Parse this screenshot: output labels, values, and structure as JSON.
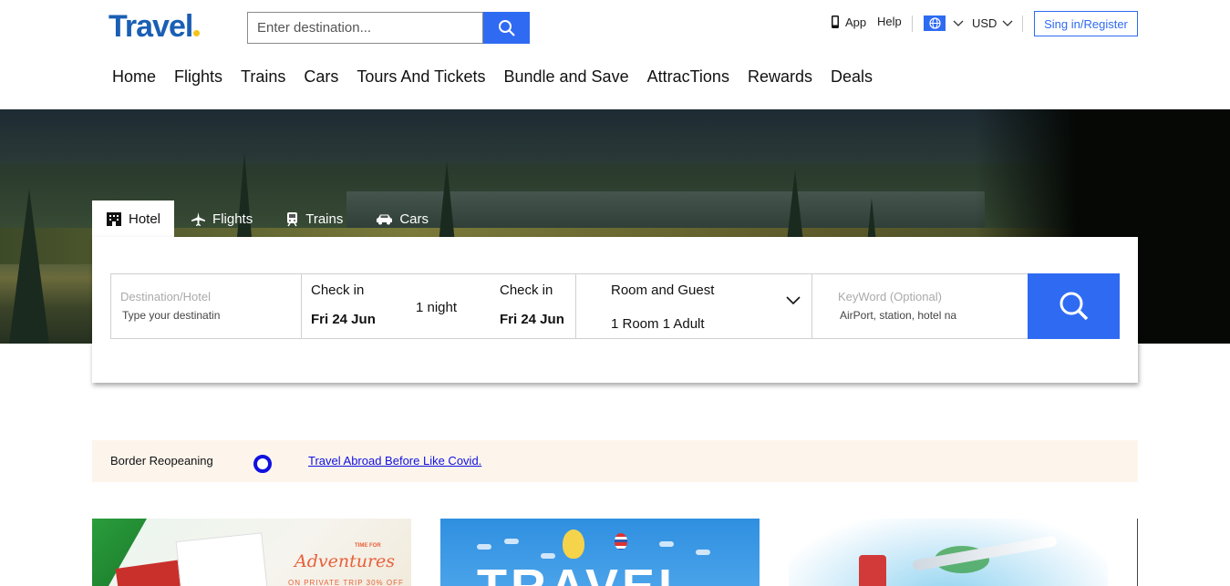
{
  "header": {
    "logo": "Travel",
    "search_placeholder": "Enter destination...",
    "app_label": "App",
    "help_label": "Help",
    "currency": "USD",
    "signin_label": "Sing in/Register"
  },
  "nav": [
    "Home",
    "Flights",
    "Trains",
    "Cars",
    "Tours And Tickets",
    "Bundle and Save",
    "AttracTions",
    "Rewards",
    "Deals"
  ],
  "tabs": [
    {
      "label": "Hotel",
      "icon": "hotel-icon",
      "active": true
    },
    {
      "label": "Flights",
      "icon": "plane-icon",
      "active": false
    },
    {
      "label": "Trains",
      "icon": "train-icon",
      "active": false
    },
    {
      "label": "Cars",
      "icon": "car-icon",
      "active": false
    }
  ],
  "search_panel": {
    "destination_label": "Destination/Hotel",
    "destination_placeholder": "Type your destinatin",
    "checkin_label": "Check in",
    "checkin_value": "Fri 24 Jun",
    "nights": "1 night",
    "checkout_label": "Check in",
    "checkout_value": "Fri 24 Jun",
    "room_label": "Room and Guest",
    "room_value": "1 Room 1 Adult",
    "keyword_label": "KeyWord (Optional)",
    "keyword_placeholder": "AirPort, station, hotel na"
  },
  "notice": {
    "label": "Border Reopeaning",
    "link": "Travel Abroad Before Like Covid."
  },
  "promos": {
    "card1_title": "Adventures",
    "card1_small": "TIME FOR",
    "card1_sub": "ON PRIVATE TRIP 30% OFF",
    "card2_title": "TRAVEL"
  },
  "colors": {
    "brand": "#1a5fb4",
    "accent": "#2f6bf2",
    "notice_bg": "#fdf5ec",
    "link": "#1010e0"
  }
}
